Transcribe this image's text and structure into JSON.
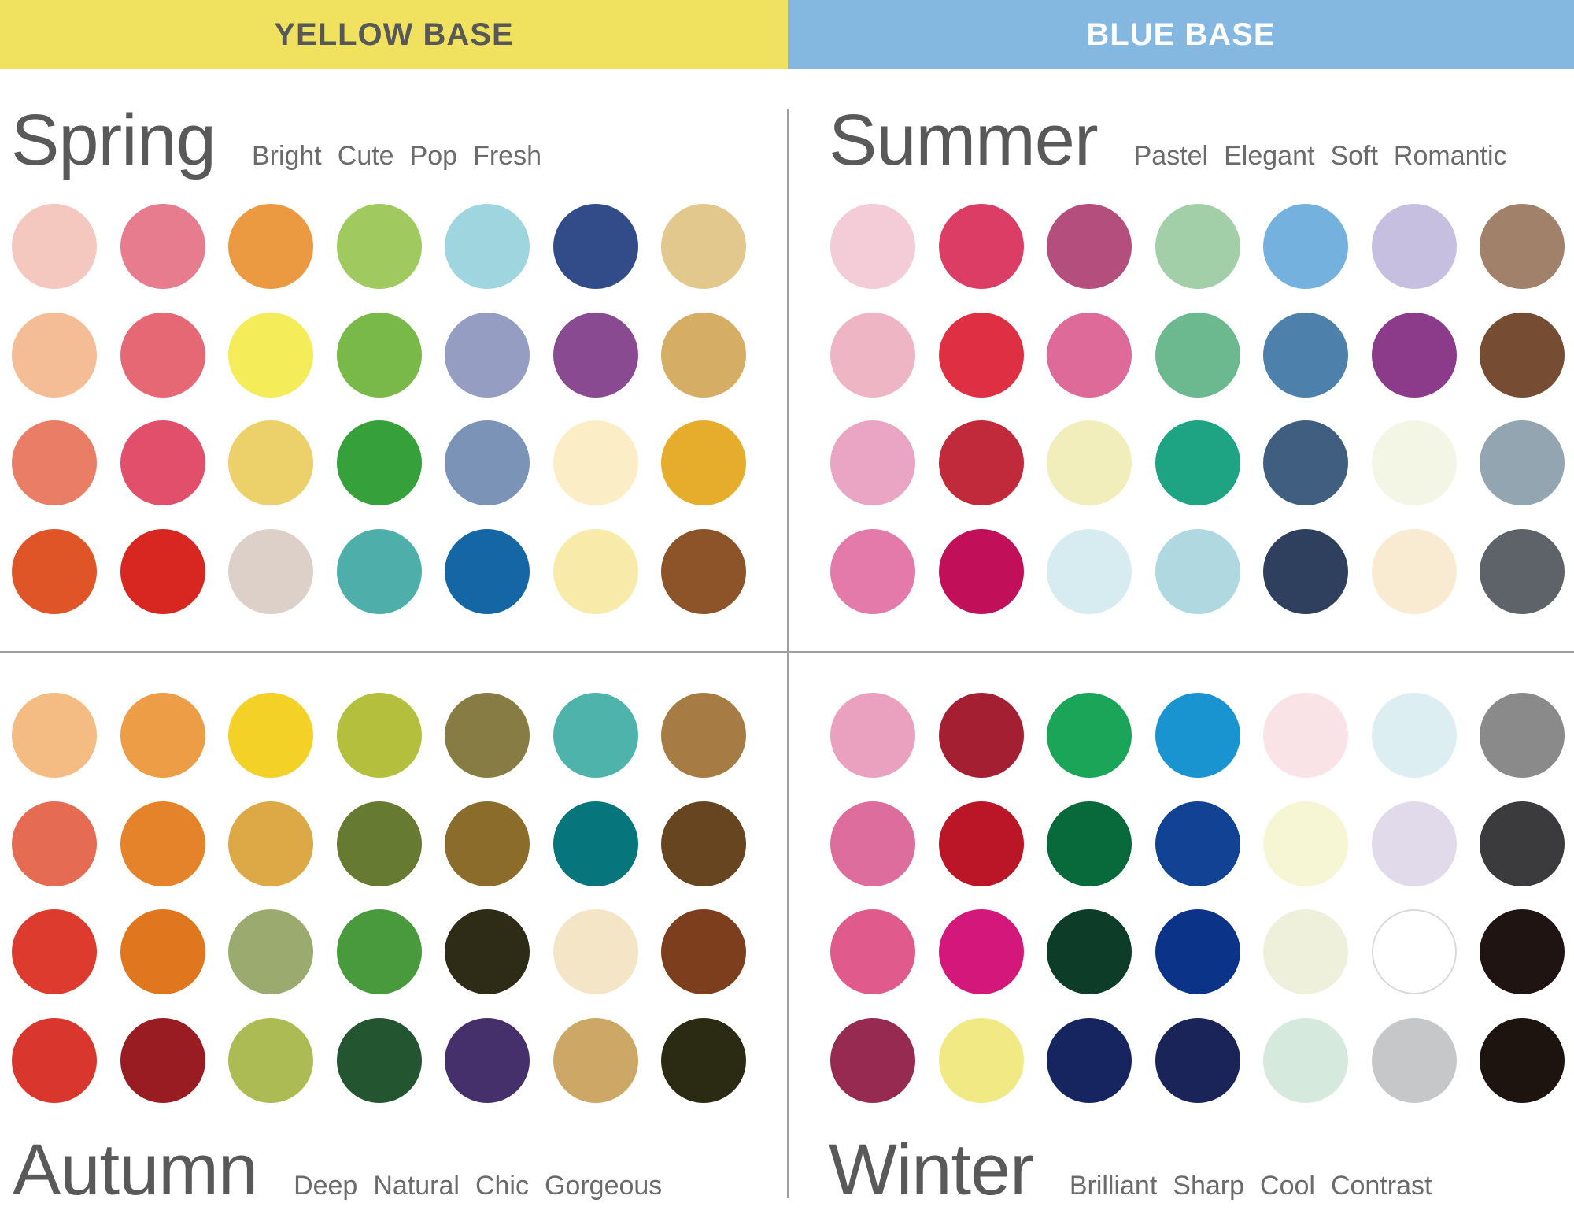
{
  "header": {
    "yellow_base": {
      "label": "YELLOW BASE",
      "background": "#f0e15e",
      "text_color": "#585858"
    },
    "blue_base": {
      "label": "BLUE BASE",
      "background": "#84b8e0",
      "text_color": "#ffffff"
    }
  },
  "seasons": {
    "spring": {
      "name": "Spring",
      "keywords": [
        "Bright",
        "Cute",
        "Pop",
        "Fresh"
      ],
      "swatches": [
        [
          "#f4c8bf",
          "#e67c8d",
          "#ec9a42",
          "#a0c95f",
          "#9ed5de",
          "#324b89",
          "#e2c88d"
        ],
        [
          "#f4bd95",
          "#e66874",
          "#f4ec58",
          "#79b949",
          "#959ec2",
          "#894a91",
          "#d6ad64"
        ],
        [
          "#ea7d66",
          "#e24f6b",
          "#ecd06a",
          "#36a13a",
          "#7c93b8",
          "#fbedc5",
          "#e6ad2c"
        ],
        [
          "#e05528",
          "#d82720",
          "#ddd0c8",
          "#4eafaa",
          "#1466a5",
          "#f8ebaa",
          "#8d5329"
        ]
      ]
    },
    "summer": {
      "name": "Summer",
      "keywords": [
        "Pastel",
        "Elegant",
        "Soft",
        "Romantic"
      ],
      "swatches": [
        [
          "#f3ccd7",
          "#db3d65",
          "#b44f7d",
          "#a2cfa8",
          "#75b1df",
          "#c6bfe0",
          "#a1816a"
        ],
        [
          "#eeb5c4",
          "#df3043",
          "#de6a9a",
          "#6cb98f",
          "#4e80ac",
          "#8b3b8a",
          "#764c32"
        ],
        [
          "#eba5c4",
          "#c02a3a",
          "#f1eebb",
          "#1ea482",
          "#405f80",
          "#f3f6e4",
          "#92a5b0"
        ],
        [
          "#e37aaa",
          "#c20f59",
          "#d7ecf0",
          "#afd8e0",
          "#2f405e",
          "#f8ebd2",
          "#5e6369"
        ]
      ]
    },
    "autumn": {
      "name": "Autumn",
      "keywords": [
        "Deep",
        "Natural",
        "Chic",
        "Gorgeous"
      ],
      "swatches": [
        [
          "#f4bc82",
          "#ec9d46",
          "#f4d126",
          "#b3bf3d",
          "#867c44",
          "#4eb3aa",
          "#a77c44"
        ],
        [
          "#e56b52",
          "#e5832a",
          "#dca946",
          "#677a31",
          "#8c6c2a",
          "#07767c",
          "#674521"
        ],
        [
          "#dc3b2e",
          "#e0771f",
          "#9bab70",
          "#489a3c",
          "#2e2b17",
          "#f3e5c5",
          "#7d3e1e"
        ],
        [
          "#d9372d",
          "#991c22",
          "#adbb54",
          "#235630",
          "#45306c",
          "#cda765",
          "#2b2a13"
        ]
      ]
    },
    "winter": {
      "name": "Winter",
      "keywords": [
        "Brilliant",
        "Sharp",
        "Cool",
        "Contrast"
      ],
      "swatches": [
        [
          "#eaa1c0",
          "#a41f31",
          "#1aa558",
          "#1a93d1",
          "#f9e3e6",
          "#ddeef2",
          "#8a8a8a"
        ],
        [
          "#dd6d9c",
          "#ba1627",
          "#086a3a",
          "#114294",
          "#f6f5d4",
          "#e1daea",
          "#3b3b3d"
        ],
        [
          "#e05b8b",
          "#d4177a",
          "#0d3c28",
          "#0b3489",
          "#eef0dc",
          "#ffffff",
          "#1f1412"
        ],
        [
          "#972a51",
          "#f1ea84",
          "#162560",
          "#1a2459",
          "#d5eadd",
          "#c6c7c9",
          "#1d1410"
        ]
      ]
    }
  },
  "colors": {
    "divider": "#9e9e9e",
    "white_swatch_outline": "#d9d9d9"
  }
}
